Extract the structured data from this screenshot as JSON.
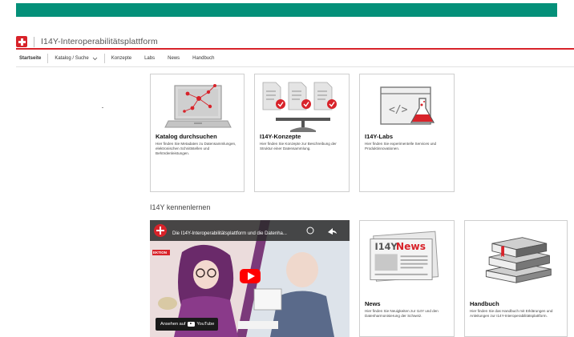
{
  "header": {
    "platform_title": "I14Y-Interoperabilitätsplattform"
  },
  "nav": {
    "items": [
      {
        "label": "Startseite",
        "active": true
      },
      {
        "label": "Katalog / Suche",
        "dropdown": true
      },
      {
        "label": "Konzepte"
      },
      {
        "label": "Labs"
      },
      {
        "label": "News"
      },
      {
        "label": "Handbuch"
      }
    ]
  },
  "cards_top": [
    {
      "title": "Katalog durchsuchen",
      "description": "Hier finden Sie Metadaten zu Datensammlungen, elektronischen Schnittstellen und Behördenleistungen."
    },
    {
      "title": "I14Y-Konzepte",
      "description": "Hier finden Sie Konzepte zur Beschreibung der Struktur einer Datensammlung."
    },
    {
      "title": "I14Y-Labs",
      "description": "Hier finden Sie experimentelle Services und Produktinnovationen."
    }
  ],
  "section": {
    "title": "I14Y kennenlernen"
  },
  "video": {
    "title": "Die I14Y-Interoperabilitätsplattform und die Datenha...",
    "watch_on": "Ansehen auf",
    "brand": "YouTube",
    "badge": "EKTION"
  },
  "cards_bottom": [
    {
      "title": "News",
      "description": "Hier finden Sie Neuigkeiten zur I14Y und den Datenharmonisierung der Schweiz.",
      "illu_text": "News",
      "illu_logo": "I14Y"
    },
    {
      "title": "Handbuch",
      "description": "Hier finden Sie das Handbuch mit Erklärungen und Anleitungen zur I14Y-Interoperabilitätsplattform."
    }
  ],
  "colors": {
    "topbar": "#049079",
    "accent": "#d8232a"
  }
}
